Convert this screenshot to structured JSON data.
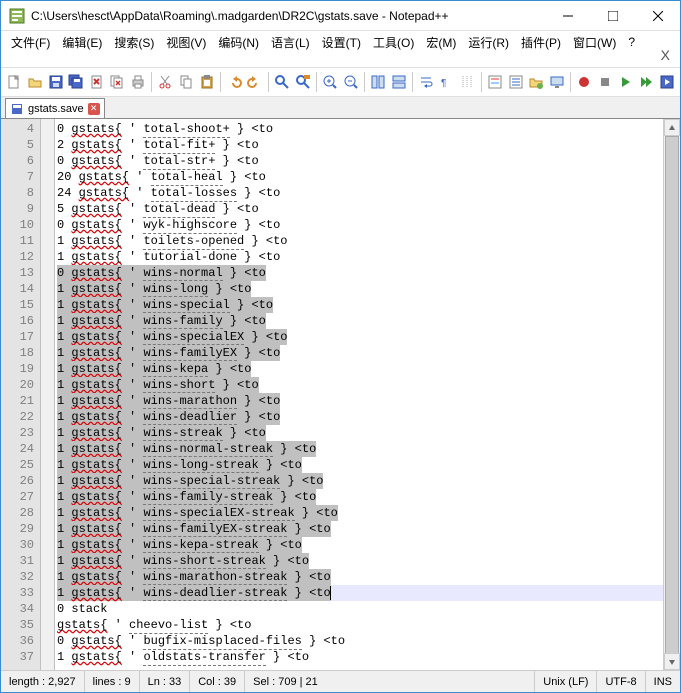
{
  "titlebar": {
    "path": "C:\\Users\\hesct\\AppData\\Roaming\\.madgarden\\DR2C\\gstats.save - Notepad++"
  },
  "menubar": {
    "items": [
      "文件(F)",
      "编辑(E)",
      "搜索(S)",
      "视图(V)",
      "编码(N)",
      "语言(L)",
      "设置(T)",
      "工具(O)",
      "宏(M)",
      "运行(R)",
      "插件(P)",
      "窗口(W)",
      "?"
    ]
  },
  "tab": {
    "name": "gstats.save"
  },
  "editor": {
    "first_line_no": 4,
    "current_line_no": 33,
    "selection_start_line": 13,
    "selection_end_line": 33,
    "lines": [
      {
        "n": 4,
        "t": "0 gstats{ ' total-shoot+ } <to"
      },
      {
        "n": 5,
        "t": "2 gstats{ ' total-fit+ } <to"
      },
      {
        "n": 6,
        "t": "0 gstats{ ' total-str+ } <to"
      },
      {
        "n": 7,
        "t": "20 gstats{ ' total-heal } <to"
      },
      {
        "n": 8,
        "t": "24 gstats{ ' total-losses } <to"
      },
      {
        "n": 9,
        "t": "5 gstats{ ' total-dead } <to"
      },
      {
        "n": 10,
        "t": "0 gstats{ ' wyk-highscore } <to"
      },
      {
        "n": 11,
        "t": "1 gstats{ ' toilets-opened } <to"
      },
      {
        "n": 12,
        "t": "1 gstats{ ' tutorial-done } <to"
      },
      {
        "n": 13,
        "t": "0 gstats{ ' wins-normal } <to"
      },
      {
        "n": 14,
        "t": "1 gstats{ ' wins-long } <to"
      },
      {
        "n": 15,
        "t": "1 gstats{ ' wins-special } <to"
      },
      {
        "n": 16,
        "t": "1 gstats{ ' wins-family } <to"
      },
      {
        "n": 17,
        "t": "1 gstats{ ' wins-specialEX } <to"
      },
      {
        "n": 18,
        "t": "1 gstats{ ' wins-familyEX } <to"
      },
      {
        "n": 19,
        "t": "1 gstats{ ' wins-kepa } <to"
      },
      {
        "n": 20,
        "t": "1 gstats{ ' wins-short } <to"
      },
      {
        "n": 21,
        "t": "1 gstats{ ' wins-marathon } <to"
      },
      {
        "n": 22,
        "t": "1 gstats{ ' wins-deadlier } <to"
      },
      {
        "n": 23,
        "t": "1 gstats{ ' wins-streak } <to"
      },
      {
        "n": 24,
        "t": "1 gstats{ ' wins-normal-streak } <to"
      },
      {
        "n": 25,
        "t": "1 gstats{ ' wins-long-streak } <to"
      },
      {
        "n": 26,
        "t": "1 gstats{ ' wins-special-streak } <to"
      },
      {
        "n": 27,
        "t": "1 gstats{ ' wins-family-streak } <to"
      },
      {
        "n": 28,
        "t": "1 gstats{ ' wins-specialEX-streak } <to"
      },
      {
        "n": 29,
        "t": "1 gstats{ ' wins-familyEX-streak } <to"
      },
      {
        "n": 30,
        "t": "1 gstats{ ' wins-kepa-streak } <to"
      },
      {
        "n": 31,
        "t": "1 gstats{ ' wins-short-streak } <to"
      },
      {
        "n": 32,
        "t": "1 gstats{ ' wins-marathon-streak } <to"
      },
      {
        "n": 33,
        "t": "1 gstats{ ' wins-deadlier-streak } <to"
      },
      {
        "n": 34,
        "t": "0 stack"
      },
      {
        "n": 35,
        "t": "gstats{ ' cheevo-list } <to"
      },
      {
        "n": 36,
        "t": "0 gstats{ ' bugfix-misplaced-files } <to"
      },
      {
        "n": 37,
        "t": "1 gstats{ ' oldstats-transfer } <to"
      }
    ]
  },
  "statusbar": {
    "length": "length : 2,927",
    "lines": "lines : 9",
    "ln": "Ln : 33",
    "col": "Col : 39",
    "sel": "Sel : 709 | 21",
    "eol": "Unix (LF)",
    "enc": "UTF-8",
    "ins": "INS"
  }
}
